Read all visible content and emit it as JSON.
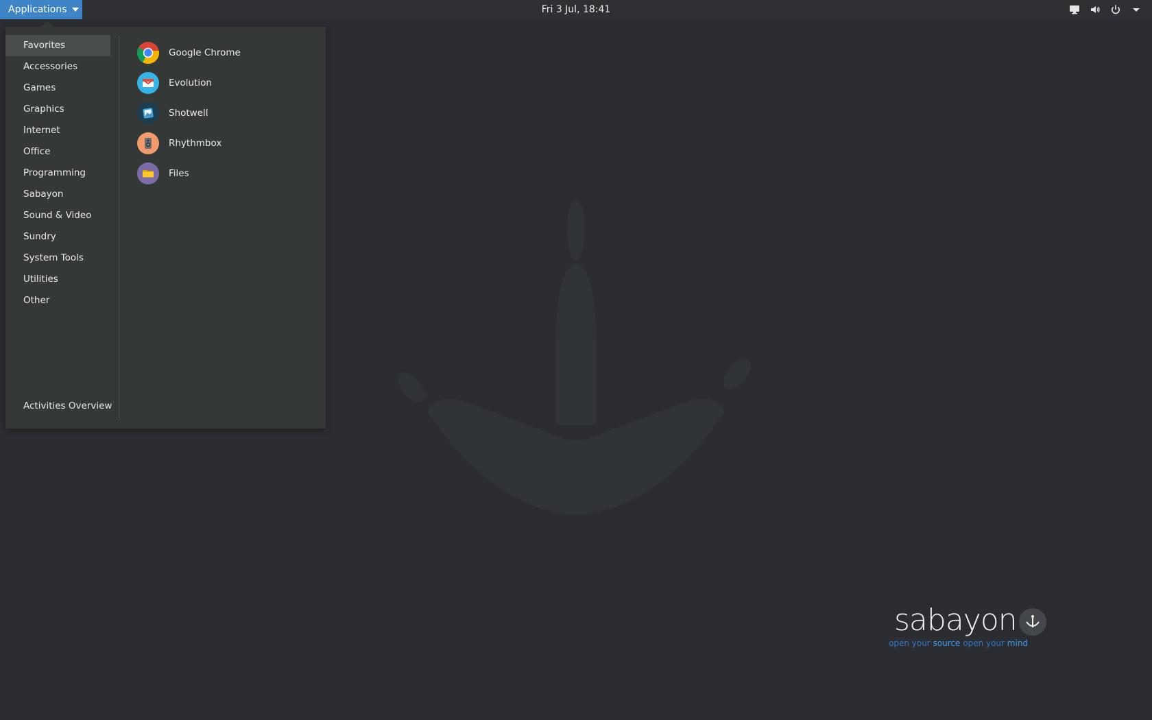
{
  "topbar": {
    "applications_label": "Applications",
    "clock": "Fri  3 Jul, 18:41",
    "tray": [
      "display-icon",
      "volume-icon",
      "power-icon",
      "chevron-down-icon"
    ]
  },
  "menu": {
    "categories": [
      {
        "label": "Favorites",
        "selected": true
      },
      {
        "label": "Accessories"
      },
      {
        "label": "Games"
      },
      {
        "label": "Graphics"
      },
      {
        "label": "Internet"
      },
      {
        "label": "Office"
      },
      {
        "label": "Programming"
      },
      {
        "label": "Sabayon"
      },
      {
        "label": "Sound & Video"
      },
      {
        "label": "Sundry"
      },
      {
        "label": "System Tools"
      },
      {
        "label": "Utilities"
      },
      {
        "label": "Other"
      }
    ],
    "activities_label": "Activities Overview",
    "apps": [
      {
        "label": "Google Chrome",
        "icon": "chrome-icon"
      },
      {
        "label": "Evolution",
        "icon": "evolution-icon"
      },
      {
        "label": "Shotwell",
        "icon": "shotwell-icon"
      },
      {
        "label": "Rhythmbox",
        "icon": "rhythmbox-icon"
      },
      {
        "label": "Files",
        "icon": "files-icon"
      }
    ]
  },
  "wallpaper": {
    "brand_name": "sabayon",
    "tagline": {
      "p1": "open your ",
      "p2": "source",
      "p3": " open your ",
      "p4": "mind"
    },
    "colors": {
      "background": "#2b2d32",
      "accent": "#3d85c6",
      "tagline": "#2f79c6"
    }
  }
}
